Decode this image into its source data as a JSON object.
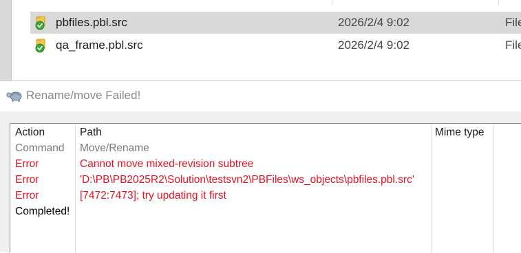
{
  "explorer": {
    "files": [
      {
        "name": "pbfiles.pbl.src",
        "date": "2026/2/4 9:02",
        "type": "File",
        "selected": true,
        "icon": "svn-folder-normal-icon"
      },
      {
        "name": "qa_frame.pbl.src",
        "date": "2026/2/4 9:02",
        "type": "File",
        "selected": false,
        "icon": "svn-folder-normal-icon"
      }
    ]
  },
  "dialog": {
    "title": "Rename/move Failed!",
    "icon": "tortoise-icon",
    "columns": {
      "action": "Action",
      "path": "Path",
      "mime": "Mime type"
    },
    "rows": [
      {
        "action": "Command",
        "path": "Move/Rename",
        "kind": "command"
      },
      {
        "action": "Error",
        "path": "Cannot move mixed-revision subtree",
        "kind": "error"
      },
      {
        "action": "Error",
        "path": " 'D:\\PB\\PB2025R2\\Solution\\testsvn2\\PBFiles\\ws_objects\\pbfiles.pbl.src'",
        "kind": "error"
      },
      {
        "action": "Error",
        "path": " [7472:7473]; try updating it first",
        "kind": "error"
      },
      {
        "action": "Completed!",
        "path": "",
        "kind": "completed"
      }
    ]
  },
  "colors": {
    "error": "#e81123",
    "command": "#7a7a7a",
    "selected_row": "#d9d9d9",
    "svn_ok_green": "#3aa83a",
    "folder_yellow": "#f2c94c"
  }
}
